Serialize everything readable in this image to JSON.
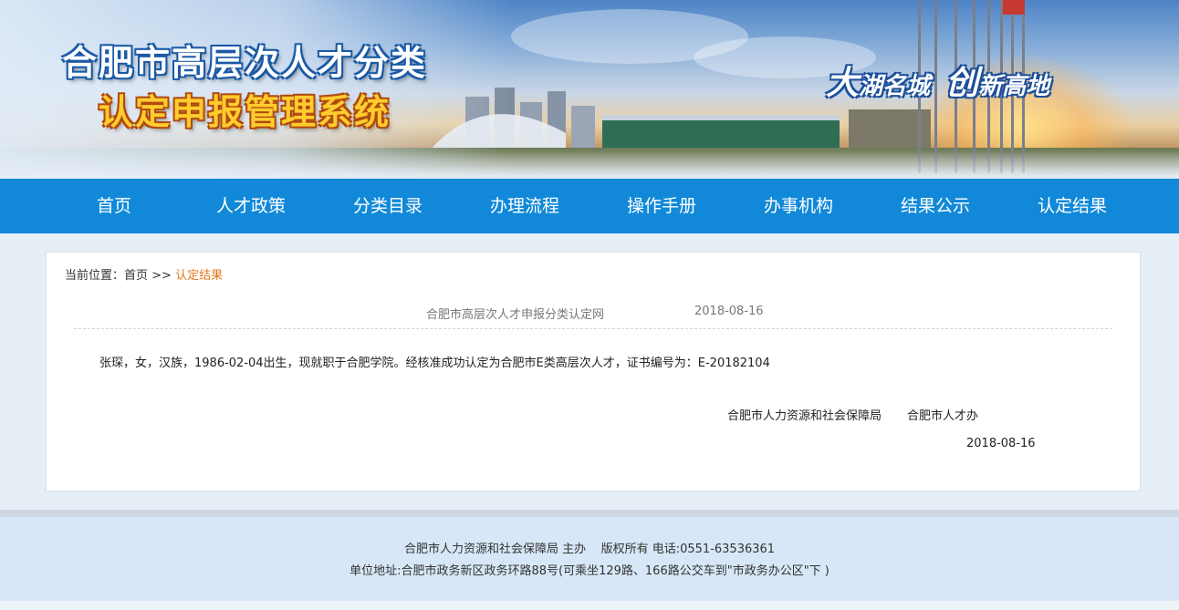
{
  "header": {
    "title_line1": "合肥市高层次人才分类",
    "title_line2": "认定申报管理系统",
    "slogan_part1_big": "大",
    "slogan_part1_rest": "湖名城",
    "slogan_part2_big": "创",
    "slogan_part2_rest": "新高地"
  },
  "nav": {
    "items": [
      "首页",
      "人才政策",
      "分类目录",
      "办理流程",
      "操作手册",
      "办事机构",
      "结果公示",
      "认定结果"
    ]
  },
  "breadcrumb": {
    "prefix": "当前位置：",
    "home": "首页",
    "separator": " >> ",
    "current": "认定结果"
  },
  "article": {
    "source": "合肥市高层次人才申报分类认定网",
    "date": "2018-08-16",
    "body": "张琛，女，汉族，1986-02-04出生，现就职于合肥学院。经核准成功认定为合肥市E类高层次人才，证书编号为：E-20182104",
    "signer1": "合肥市人力资源和社会保障局",
    "signer2": "合肥市人才办",
    "sign_date": "2018-08-16"
  },
  "footer": {
    "line1": "合肥市人力资源和社会保障局 主办    版权所有 电话:0551-63536361",
    "line2": "单位地址:合肥市政务新区政务环路88号(可乘坐129路、166路公交车到\"市政务办公区\"下 )"
  },
  "colors": {
    "nav_bg": "#1189d8",
    "breadcrumb_current": "#e5771e",
    "footer_bg": "#d7e7f7",
    "page_bg": "#e6eef6"
  }
}
